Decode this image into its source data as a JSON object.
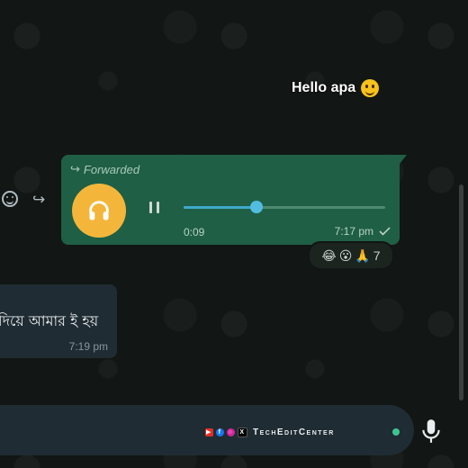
{
  "chat": {
    "greeting_text": "Hello apa",
    "greeting_emoji_icon": "slightly-smiling-face-icon"
  },
  "voice_message": {
    "forwarded_label": "Forwarded",
    "avatar_icon": "headphones-icon",
    "elapsed": "0:09",
    "progress": 0.36,
    "sent_time": "7:17 pm",
    "status_icon": "single-check-icon"
  },
  "reactions": {
    "emojis": [
      "😂",
      "😮",
      "🙏"
    ],
    "count": "7"
  },
  "incoming_message": {
    "text": "দিয়ে আমার ই হয়",
    "time": "7:19 pm"
  },
  "input_bar": {
    "watermark_text": "TechEditCenter"
  },
  "colors": {
    "outgoing_bubble": "#1f5f45",
    "incoming_bubble": "#202c33",
    "avatar": "#f4b63a",
    "progress": "#53bde0"
  }
}
